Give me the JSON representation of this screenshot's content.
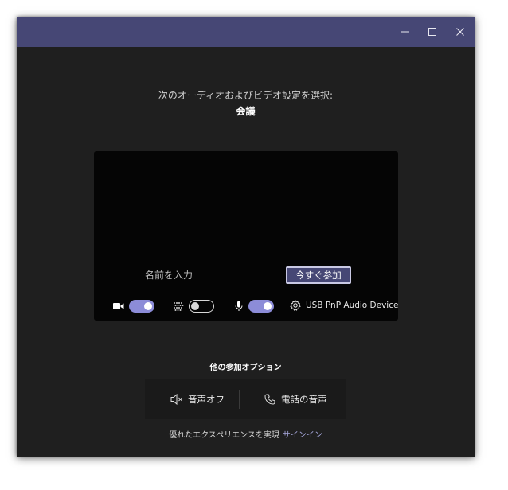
{
  "titlebar": {
    "minimize_icon": "minimize-icon",
    "maximize_icon": "maximize-icon",
    "close_icon": "close-icon",
    "color": "#464775"
  },
  "header": {
    "prompt": "次のオーディオおよびビデオ設定を選択:",
    "meeting_name": "会議"
  },
  "preview": {
    "name_placeholder": "名前を入力",
    "join_button": "今すぐ参加"
  },
  "controls": {
    "camera": {
      "icon": "camera-icon",
      "on": true
    },
    "background_blur": {
      "icon": "blur-icon",
      "on": false
    },
    "microphone": {
      "icon": "microphone-icon",
      "on": true
    },
    "device": {
      "icon": "gear-icon",
      "label": "USB PnP Audio Device"
    }
  },
  "other_options": {
    "title": "他の参加オプション",
    "audio_off": {
      "icon": "speaker-off-icon",
      "label": "音声オフ"
    },
    "phone_audio": {
      "icon": "phone-icon",
      "label": "電話の音声"
    }
  },
  "footer": {
    "text": "優れたエクスペリエンスを実現",
    "signin_link": "サインイン"
  },
  "colors": {
    "accent": "#464775",
    "toggle_on": "#8c8cd8",
    "link": "#a6a7dc",
    "background": "#1f1f1f"
  }
}
